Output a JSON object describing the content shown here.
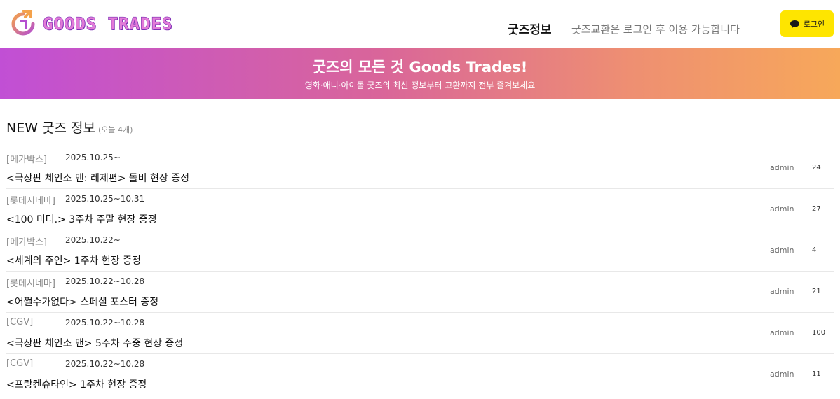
{
  "header": {
    "logo_text": "GOODS TRADES",
    "nav_main": "굿즈정보",
    "nav_note": "굿즈교환은 로그인 후 이용 가능합니다",
    "login_label": "로그인"
  },
  "banner": {
    "title": "굿즈의 모든 것 Goods Trades!",
    "subtitle": "영화·애니·아이돌 굿즈의 최신 정보부터 교환까지 전부 즐겨보세요"
  },
  "section": {
    "title": "NEW 굿즈 정보",
    "sub": "(오늘 4개)"
  },
  "items": [
    {
      "cinema": "[메가박스]",
      "period": "2025.10.25~",
      "title": "<극장판 체인소 맨: 레제편> 돌비 현장 증정",
      "author": "admin",
      "views": "24"
    },
    {
      "cinema": "[롯데시네마]",
      "period": "2025.10.25~10.31",
      "title": "<100 미터.> 3주차 주말 현장 증정",
      "author": "admin",
      "views": "27"
    },
    {
      "cinema": "[메가박스]",
      "period": "2025.10.22~",
      "title": "<세계의 주인> 1주차 현장 증정",
      "author": "admin",
      "views": "4"
    },
    {
      "cinema": "[롯데시네마]",
      "period": "2025.10.22~10.28",
      "title": "<어쩔수가없다> 스페셜 포스터 증정",
      "author": "admin",
      "views": "21"
    },
    {
      "cinema": "[CGV]",
      "period": "2025.10.22~10.28",
      "title": "<극장판 체인소 맨> 5주차 주중 현장 증정",
      "author": "admin",
      "views": "100"
    },
    {
      "cinema": "[CGV]",
      "period": "2025.10.22~10.28",
      "title": "<프랑켄슈타인> 1주차 현장 증정",
      "author": "admin",
      "views": "11"
    }
  ],
  "colors": {
    "login_bg": "#fee500",
    "banner_start": "#c14fd5",
    "banner_end": "#f7a85a",
    "logo_fill": "#e27bd8"
  },
  "icons": {
    "logo": "logo-icon",
    "login": "chat-bubble-icon"
  }
}
